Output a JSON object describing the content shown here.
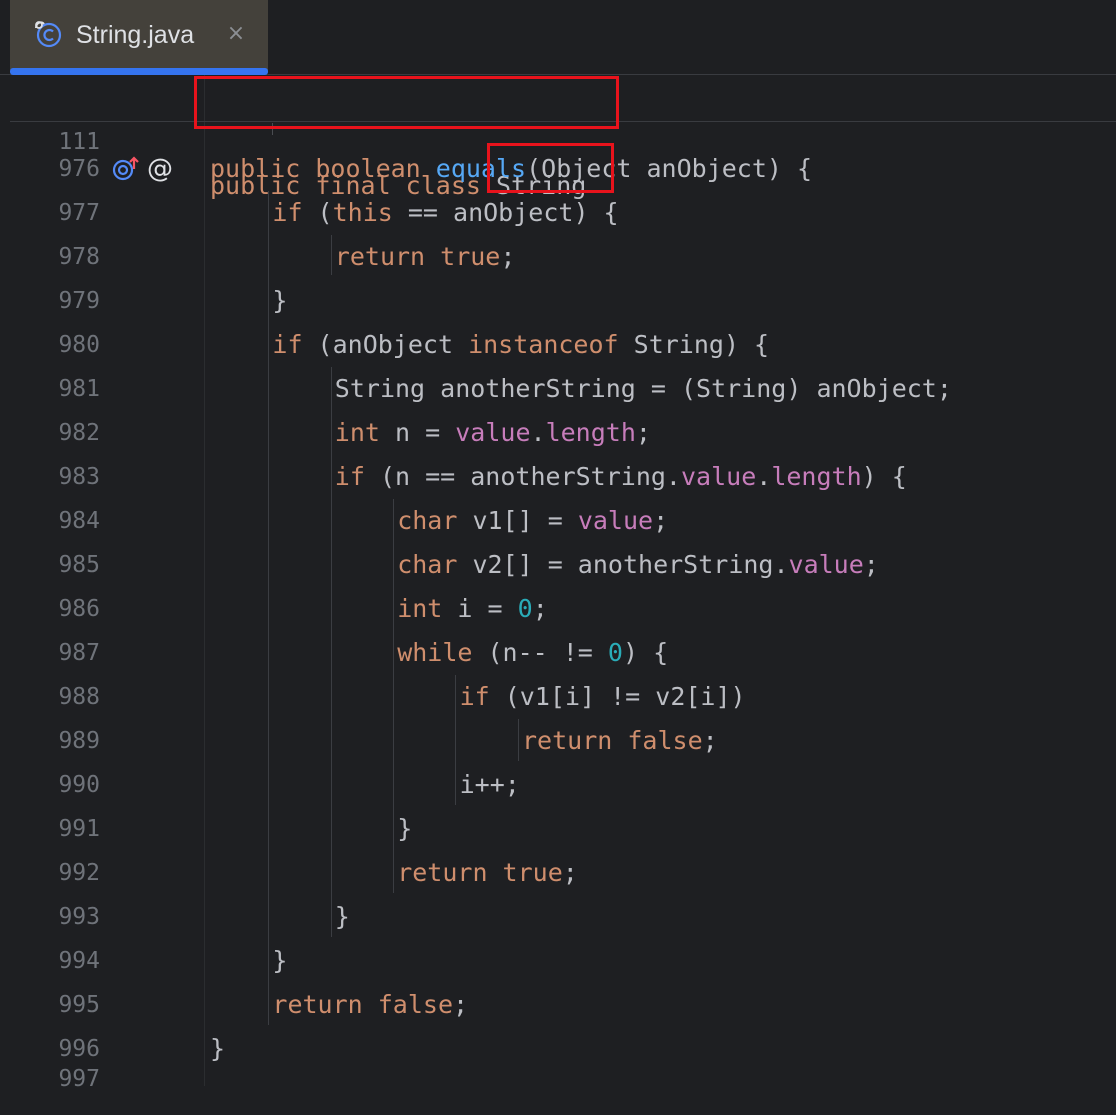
{
  "tab": {
    "title": "String.java",
    "close_glyph": "×",
    "icon": "class-file-icon"
  },
  "editor": {
    "sticky_line": {
      "number": "111",
      "tokens": [
        {
          "t": "public final class ",
          "c": "kw"
        },
        {
          "t": "String",
          "c": ""
        }
      ]
    },
    "gutter_icons": [
      "implements-override-icon",
      "at-annotation-icon"
    ],
    "at_glyph": "@",
    "lines": [
      {
        "n": "976",
        "tokens": [
          {
            "t": "public boolean ",
            "c": "kw"
          },
          {
            "t": "equals",
            "c": "fn"
          },
          {
            "t": "(Object anObject) {",
            "c": ""
          }
        ]
      },
      {
        "n": "977",
        "tokens": [
          {
            "t": "if ",
            "c": "kw"
          },
          {
            "t": "(",
            "c": ""
          },
          {
            "t": "this",
            "c": "kw"
          },
          {
            "t": " == anObject) {",
            "c": ""
          }
        ]
      },
      {
        "n": "978",
        "tokens": [
          {
            "t": "return true",
            "c": "kw"
          },
          {
            "t": ";",
            "c": ""
          }
        ]
      },
      {
        "n": "979",
        "tokens": [
          {
            "t": "}",
            "c": ""
          }
        ]
      },
      {
        "n": "980",
        "tokens": [
          {
            "t": "if ",
            "c": "kw"
          },
          {
            "t": "(anObject ",
            "c": ""
          },
          {
            "t": "instanceof ",
            "c": "kw"
          },
          {
            "t": "String) {",
            "c": ""
          }
        ]
      },
      {
        "n": "981",
        "tokens": [
          {
            "t": "String anotherString = (String) anObject;",
            "c": ""
          }
        ]
      },
      {
        "n": "982",
        "tokens": [
          {
            "t": "int ",
            "c": "kw"
          },
          {
            "t": "n = ",
            "c": ""
          },
          {
            "t": "value",
            "c": "fld"
          },
          {
            "t": ".",
            "c": ""
          },
          {
            "t": "length",
            "c": "fld"
          },
          {
            "t": ";",
            "c": ""
          }
        ]
      },
      {
        "n": "983",
        "tokens": [
          {
            "t": "if ",
            "c": "kw"
          },
          {
            "t": "(n == anotherString.",
            "c": ""
          },
          {
            "t": "value",
            "c": "fld"
          },
          {
            "t": ".",
            "c": ""
          },
          {
            "t": "length",
            "c": "fld"
          },
          {
            "t": ") {",
            "c": ""
          }
        ]
      },
      {
        "n": "984",
        "tokens": [
          {
            "t": "char ",
            "c": "kw"
          },
          {
            "t": "v1[] = ",
            "c": ""
          },
          {
            "t": "value",
            "c": "fld"
          },
          {
            "t": ";",
            "c": ""
          }
        ]
      },
      {
        "n": "985",
        "tokens": [
          {
            "t": "char ",
            "c": "kw"
          },
          {
            "t": "v2[] = anotherString.",
            "c": ""
          },
          {
            "t": "value",
            "c": "fld"
          },
          {
            "t": ";",
            "c": ""
          }
        ]
      },
      {
        "n": "986",
        "tokens": [
          {
            "t": "int ",
            "c": "kw"
          },
          {
            "t": "i = ",
            "c": ""
          },
          {
            "t": "0",
            "c": "num"
          },
          {
            "t": ";",
            "c": ""
          }
        ]
      },
      {
        "n": "987",
        "tokens": [
          {
            "t": "while ",
            "c": "kw"
          },
          {
            "t": "(n-- != ",
            "c": ""
          },
          {
            "t": "0",
            "c": "num"
          },
          {
            "t": ") {",
            "c": ""
          }
        ]
      },
      {
        "n": "988",
        "tokens": [
          {
            "t": "if ",
            "c": "kw"
          },
          {
            "t": "(v1[i] != v2[i])",
            "c": ""
          }
        ]
      },
      {
        "n": "989",
        "tokens": [
          {
            "t": "return false",
            "c": "kw"
          },
          {
            "t": ";",
            "c": ""
          }
        ]
      },
      {
        "n": "990",
        "tokens": [
          {
            "t": "i++;",
            "c": ""
          }
        ]
      },
      {
        "n": "991",
        "tokens": [
          {
            "t": "}",
            "c": ""
          }
        ]
      },
      {
        "n": "992",
        "tokens": [
          {
            "t": "return true",
            "c": "kw"
          },
          {
            "t": ";",
            "c": ""
          }
        ]
      },
      {
        "n": "993",
        "tokens": [
          {
            "t": "}",
            "c": ""
          }
        ]
      },
      {
        "n": "994",
        "tokens": [
          {
            "t": "}",
            "c": ""
          }
        ]
      },
      {
        "n": "995",
        "tokens": [
          {
            "t": "return false",
            "c": "kw"
          },
          {
            "t": ";",
            "c": ""
          }
        ]
      },
      {
        "n": "996",
        "tokens": [
          {
            "t": "}",
            "c": ""
          }
        ]
      },
      {
        "n": "997",
        "tokens": []
      }
    ]
  },
  "colors": {
    "background": "#1e1f22",
    "tab_background": "#44413b",
    "tab_underline": "#3574f0",
    "keyword": "#cf8e6d",
    "field": "#c77dbb",
    "number": "#2aacb8",
    "method_declaration": "#56a8f5",
    "plain_text": "#bcbec4",
    "line_number": "#6f737a",
    "highlight_box": "#e8131c"
  }
}
